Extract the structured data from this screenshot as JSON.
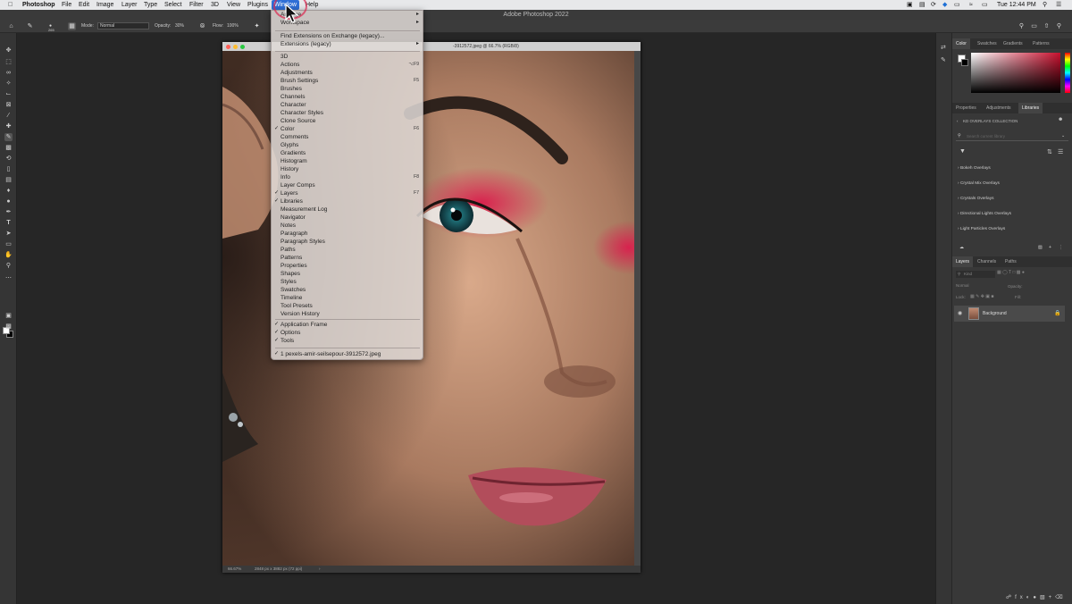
{
  "menubar": {
    "app": "Photoshop",
    "items": [
      "File",
      "Edit",
      "Image",
      "Layer",
      "Type",
      "Select",
      "Filter",
      "3D",
      "View",
      "Plugins",
      "Window",
      "Help"
    ],
    "active": "Window",
    "clock": "Tue 12:44 PM"
  },
  "titlebar": {
    "title": "Adobe Photoshop 2022"
  },
  "options": {
    "brush_size": "265",
    "mode_label": "Mode:",
    "mode_value": "Normal",
    "opacity_label": "Opacity:",
    "opacity_value": "30%",
    "flow_label": "Flow:",
    "flow_value": "100%"
  },
  "document": {
    "title": "-3912572.jpeg @ 66.7% (RGB/8)",
    "zoom": "66.67%",
    "info": "2848 px x 3882 px (72 ppi)"
  },
  "window_menu": {
    "top": [
      {
        "label": "Arrange",
        "arrow": true
      },
      {
        "label": "Workspace",
        "arrow": true
      }
    ],
    "extensions": [
      {
        "label": "Find Extensions on Exchange (legacy)..."
      },
      {
        "label": "Extensions (legacy)",
        "arrow": true
      }
    ],
    "panels": [
      {
        "label": "3D"
      },
      {
        "label": "Actions",
        "shortcut": "⌥F9"
      },
      {
        "label": "Adjustments"
      },
      {
        "label": "Brush Settings",
        "shortcut": "F5"
      },
      {
        "label": "Brushes"
      },
      {
        "label": "Channels"
      },
      {
        "label": "Character"
      },
      {
        "label": "Character Styles"
      },
      {
        "label": "Clone Source"
      },
      {
        "label": "Color",
        "checked": true,
        "shortcut": "F6"
      },
      {
        "label": "Comments"
      },
      {
        "label": "Glyphs"
      },
      {
        "label": "Gradients"
      },
      {
        "label": "Histogram"
      },
      {
        "label": "History"
      },
      {
        "label": "Info",
        "shortcut": "F8"
      },
      {
        "label": "Layer Comps"
      },
      {
        "label": "Layers",
        "checked": true,
        "shortcut": "F7"
      },
      {
        "label": "Libraries",
        "checked": true
      },
      {
        "label": "Measurement Log"
      },
      {
        "label": "Navigator"
      },
      {
        "label": "Notes"
      },
      {
        "label": "Paragraph"
      },
      {
        "label": "Paragraph Styles"
      },
      {
        "label": "Paths"
      },
      {
        "label": "Patterns"
      },
      {
        "label": "Properties"
      },
      {
        "label": "Shapes"
      },
      {
        "label": "Styles"
      },
      {
        "label": "Swatches"
      },
      {
        "label": "Timeline"
      },
      {
        "label": "Tool Presets"
      },
      {
        "label": "Version History"
      }
    ],
    "frames": [
      {
        "label": "Application Frame",
        "checked": true
      },
      {
        "label": "Options",
        "checked": true
      },
      {
        "label": "Tools",
        "checked": true
      }
    ],
    "docs": [
      {
        "label": "1 pexels-amir-seilsepour-3912572.jpeg",
        "checked": true
      }
    ]
  },
  "panels": {
    "color_tabs": [
      "Color",
      "Swatches",
      "Gradients",
      "Patterns"
    ],
    "prop_tabs": [
      "Properties",
      "Adjustments",
      "Libraries"
    ],
    "library_name": "KD OVERLAYS COLLECTION",
    "search_placeholder": "Search current library",
    "library_groups": [
      "Bokeh Overlays",
      "Crystal Mix Overlays",
      "Crystals Overlays",
      "Directional Lights Overlays",
      "Light Particles Overlays"
    ],
    "layer_tabs": [
      "Layers",
      "Channels",
      "Paths"
    ],
    "kind_label": "Kind",
    "blend_mode": "Normal",
    "opacity_label": "Opacity:",
    "lock_label": "Lock:",
    "fill_label": "Fill:",
    "layer_name": "Background"
  },
  "colors": {
    "accent": "#2f6fd6",
    "menu_bg": "#e0dad6",
    "panel_bg": "#383838",
    "app_bg": "#262626"
  }
}
